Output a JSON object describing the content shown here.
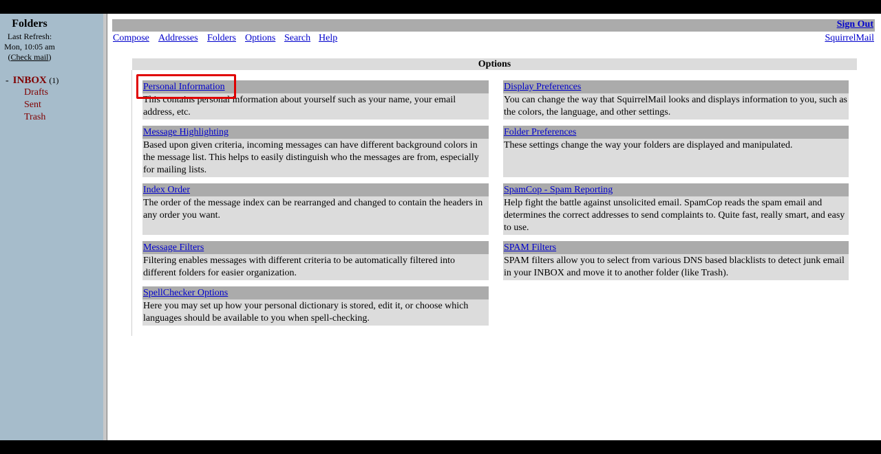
{
  "folder_pane": {
    "title": "Folders",
    "last_refresh_label": "Last Refresh:",
    "last_refresh_time": "Mon, 10:05 am",
    "check_mail_open": "(",
    "check_mail_label": "Check mail",
    "check_mail_close": ")",
    "inbox": {
      "dash": "-",
      "name": "INBOX",
      "count": "(1)"
    },
    "folders": [
      "Drafts",
      "Sent",
      "Trash"
    ]
  },
  "header": {
    "sign_out": "Sign Out",
    "nav": [
      "Compose",
      "Addresses",
      "Folders",
      "Options",
      "Search",
      "Help"
    ],
    "brand_link": "SquirrelMail"
  },
  "options": {
    "heading": "Options",
    "left": [
      {
        "title": "Personal Information",
        "desc": "This contains personal information about yourself such as your name, your email address, etc."
      },
      {
        "title": "Message Highlighting",
        "desc": "Based upon given criteria, incoming messages can have different background colors in the message list. This helps to easily distinguish who the messages are from, especially for mailing lists."
      },
      {
        "title": "Index Order",
        "desc": "The order of the message index can be rearranged and changed to contain the headers in any order you want."
      },
      {
        "title": "Message Filters",
        "desc": "Filtering enables messages with different criteria to be automatically filtered into different folders for easier organization."
      },
      {
        "title": "SpellChecker Options",
        "desc": "Here you may set up how your personal dictionary is stored, edit it, or choose which languages should be available to you when spell-checking."
      }
    ],
    "right": [
      {
        "title": "Display Preferences",
        "desc": "You can change the way that SquirrelMail looks and displays information to you, such as the colors, the language, and other settings."
      },
      {
        "title": "Folder Preferences",
        "desc": "These settings change the way your folders are displayed and manipulated."
      },
      {
        "title": "SpamCop - Spam Reporting",
        "desc": "Help fight the battle against unsolicited email. SpamCop reads the spam email and determines the correct addresses to send complaints to. Quite fast, really smart, and easy to use."
      },
      {
        "title": "SPAM Filters",
        "desc": "SPAM filters allow you to select from various DNS based blacklists to detect junk email in your INBOX and move it to another folder (like Trash)."
      }
    ]
  },
  "colors": {
    "folder_pane_bg": "#a6bccb",
    "title_bar_bg": "#ababab",
    "option_bg": "#dcdcdc",
    "link": "#0000cc",
    "folder_text": "#800000",
    "highlight_box": "#e00000"
  }
}
